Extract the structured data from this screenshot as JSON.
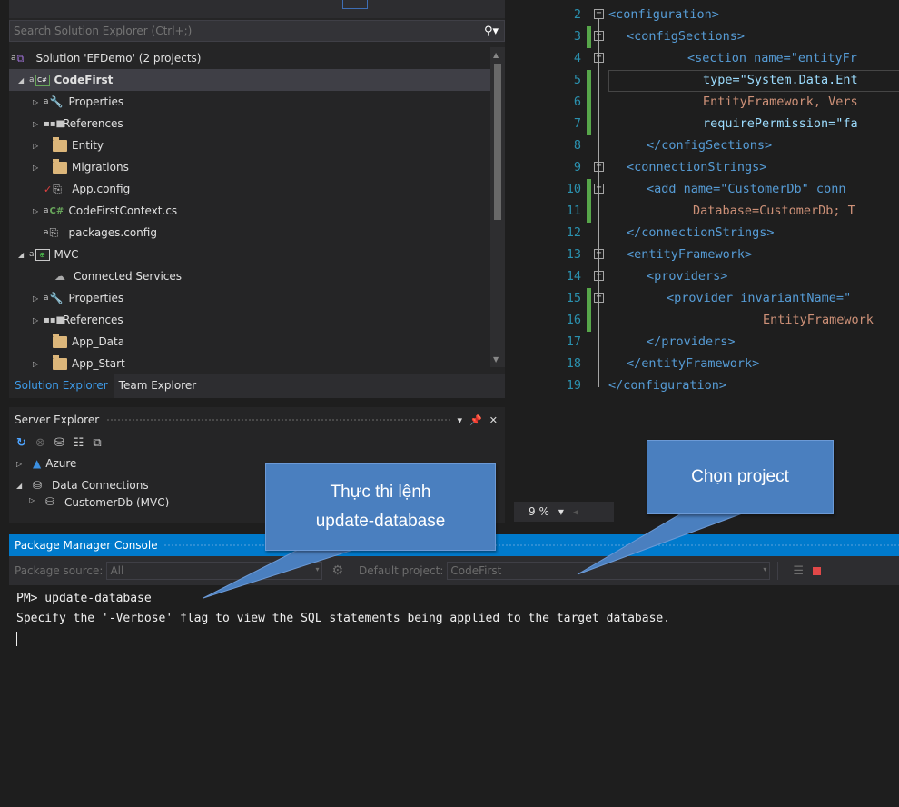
{
  "solution_explorer": {
    "search_placeholder": "Search Solution Explorer (Ctrl+;)",
    "items": [
      {
        "label": "Solution 'EFDemo' (2 projects)"
      },
      {
        "label": "CodeFirst"
      },
      {
        "label": "Properties"
      },
      {
        "label": "References"
      },
      {
        "label": "Entity"
      },
      {
        "label": "Migrations"
      },
      {
        "label": "App.config"
      },
      {
        "label": "CodeFirstContext.cs"
      },
      {
        "label": "packages.config"
      },
      {
        "label": "MVC"
      },
      {
        "label": "Connected Services"
      },
      {
        "label": "Properties"
      },
      {
        "label": "References"
      },
      {
        "label": "App_Data"
      },
      {
        "label": "App_Start"
      }
    ],
    "tabs": [
      "Solution Explorer",
      "Team Explorer"
    ]
  },
  "server_explorer": {
    "title": "Server Explorer",
    "items": [
      {
        "label": "Azure"
      },
      {
        "label": "Data Connections"
      },
      {
        "label": "CustomerDb (MVC)"
      }
    ]
  },
  "editor": {
    "zoom": "9 %",
    "lines": [
      {
        "n": "2",
        "text": "<configuration>"
      },
      {
        "n": "3",
        "text": "<configSections>"
      },
      {
        "n": "4",
        "text": "<section name=\"entityFr"
      },
      {
        "n": "5",
        "text": "type=\"System.Data.Ent"
      },
      {
        "n": "6",
        "text": "EntityFramework, Vers"
      },
      {
        "n": "7",
        "text": "requirePermission=\"fa"
      },
      {
        "n": "8",
        "text": "</configSections>"
      },
      {
        "n": "9",
        "text": "<connectionStrings>"
      },
      {
        "n": "10",
        "text": "<add name=\"CustomerDb\" conn"
      },
      {
        "n": "11",
        "text": "Database=CustomerDb; T"
      },
      {
        "n": "12",
        "text": "</connectionStrings>"
      },
      {
        "n": "13",
        "text": "<entityFramework>"
      },
      {
        "n": "14",
        "text": "<providers>"
      },
      {
        "n": "15",
        "text": "<provider invariantName=\""
      },
      {
        "n": "16",
        "text": "EntityFramework"
      },
      {
        "n": "17",
        "text": "</providers>"
      },
      {
        "n": "18",
        "text": "</entityFramework>"
      },
      {
        "n": "19",
        "text": "</configuration>"
      }
    ]
  },
  "pmc": {
    "title": "Package Manager Console",
    "package_source_label": "Package source:",
    "package_source_value": "All",
    "default_project_label": "Default project:",
    "default_project_value": "CodeFirst",
    "output": [
      "PM> update-database",
      "Specify the '-Verbose' flag to view the SQL statements being applied to the target database."
    ]
  },
  "callouts": {
    "update_line1": "Thực thi lệnh",
    "update_line2": "update-database",
    "project": "Chọn project"
  }
}
